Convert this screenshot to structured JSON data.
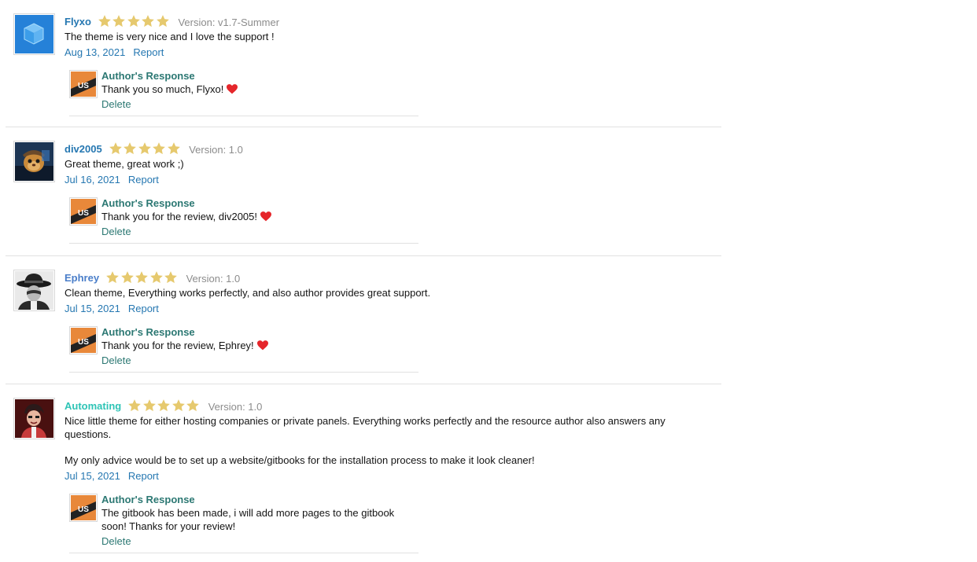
{
  "reviews": [
    {
      "username": "Flyxo",
      "rating": 5,
      "version": "Version: v1.7-Summer",
      "text": [
        "The theme is very nice and I love the support !"
      ],
      "date": "Aug 13, 2021",
      "report_label": "Report",
      "response": {
        "title": "Author's Response",
        "text": "Thank you so much, Flyxo!",
        "delete_label": "Delete"
      }
    },
    {
      "username": "div2005",
      "rating": 5,
      "version": "Version: 1.0",
      "text": [
        "Great theme, great work ;)"
      ],
      "date": "Jul 16, 2021",
      "report_label": "Report",
      "response": {
        "title": "Author's Response",
        "text": "Thank you for the review, div2005!",
        "delete_label": "Delete"
      }
    },
    {
      "username": "Ephrey",
      "rating": 5,
      "version": "Version: 1.0",
      "text": [
        "Clean theme, Everything works perfectly, and also author provides great support."
      ],
      "date": "Jul 15, 2021",
      "report_label": "Report",
      "response": {
        "title": "Author's Response",
        "text": "Thank you for the review, Ephrey!",
        "delete_label": "Delete"
      }
    },
    {
      "username": "Automating",
      "rating": 5,
      "version": "Version: 1.0",
      "text": [
        "Nice little theme for either hosting companies or private panels. Everything works perfectly and the resource author also answers any questions.",
        "My only advice would be to set up a website/gitbooks for the installation process to make it look cleaner!"
      ],
      "date": "Jul 15, 2021",
      "report_label": "Report",
      "response": {
        "title": "Author's Response",
        "text": "The gitbook has been made, i will add more pages to the gitbook soon! Thanks for your review!",
        "delete_label": "Delete"
      }
    }
  ],
  "author_avatar_text": "US",
  "colors": {
    "star": "#e6c96e",
    "heart": "#e5262b",
    "link": "#2577b1",
    "response_title": "#2c7873",
    "separator": "#e1e1e1"
  }
}
